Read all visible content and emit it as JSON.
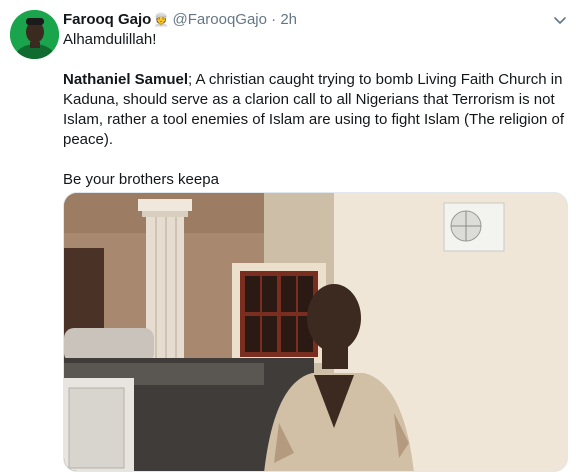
{
  "tweet": {
    "author": {
      "display_name": "Farooq Gajo",
      "verified_emoji": "👳",
      "handle": "@FarooqGajo",
      "separator": "·",
      "time": "2h"
    },
    "paragraphs": {
      "first": "Alhamdulillah!",
      "second_bold": "Nathaniel Samuel",
      "second_rest": "; A christian caught trying to bomb Living Faith Church in Kaduna, should serve as a clarion call to all Nigerians that Terrorism is not Islam, rather a tool enemies of Islam are using to fight Islam (The religion of peace).",
      "third": "Be your brothers keepa"
    },
    "media": {
      "kind": "photo"
    }
  },
  "icons": {
    "menu": "chevron-down-icon",
    "avatar": "avatar"
  },
  "colors": {
    "text": "#14171a",
    "secondary": "#657786",
    "avatar_bg": "#19a34a",
    "border": "#e1e8ed"
  }
}
